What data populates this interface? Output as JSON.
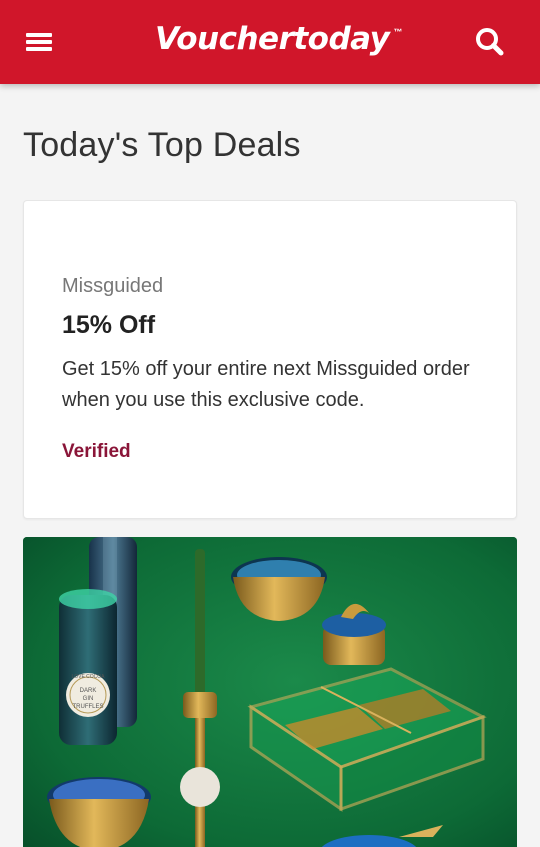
{
  "header": {
    "logo_text": "Vouchertoday",
    "logo_tm": "™",
    "menu_icon": "hamburger-menu-icon",
    "search_icon": "search-icon",
    "colors": {
      "background": "#d0162a",
      "foreground": "#ffffff"
    }
  },
  "main": {
    "title": "Today's Top Deals",
    "deals": [
      {
        "brand": "Missguided",
        "discount": "15% Off",
        "description": "Get 15% off your entire next Missguided order when you use this exclusive code.",
        "status": "Verified",
        "status_color": "#8a1538"
      }
    ],
    "promo_card": {
      "image_subject": "Gold and glass homeware on green background",
      "box_text": [
        "LOVE COCOA",
        "DARK",
        "GIN",
        "TRUFFLES"
      ]
    }
  }
}
